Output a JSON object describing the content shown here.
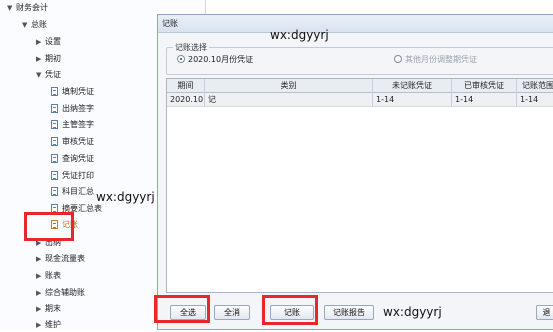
{
  "tree": {
    "items": [
      {
        "label": "财务会计",
        "arrow": "▼",
        "kind": "folder"
      },
      {
        "label": "总账",
        "arrow": "▼",
        "kind": "folder"
      },
      {
        "label": "设置",
        "arrow": "▶",
        "kind": "folder"
      },
      {
        "label": "期初",
        "arrow": "▶",
        "kind": "folder"
      },
      {
        "label": "凭证",
        "arrow": "▼",
        "kind": "folder"
      },
      {
        "label": "填制凭证",
        "kind": "doc"
      },
      {
        "label": "出纳签字",
        "kind": "doc"
      },
      {
        "label": "主管签字",
        "kind": "doc"
      },
      {
        "label": "审核凭证",
        "kind": "doc"
      },
      {
        "label": "查询凭证",
        "kind": "doc"
      },
      {
        "label": "凭证打印",
        "kind": "doc"
      },
      {
        "label": "科目汇总",
        "kind": "doc"
      },
      {
        "label": "摘要汇总表",
        "kind": "doc"
      },
      {
        "label": "记账",
        "kind": "doc",
        "selected": true
      },
      {
        "label": "出纳",
        "arrow": "▶",
        "kind": "folder"
      },
      {
        "label": "现金流量表",
        "arrow": "▶",
        "kind": "folder"
      },
      {
        "label": "账表",
        "arrow": "▶",
        "kind": "folder"
      },
      {
        "label": "综合辅助账",
        "arrow": "▶",
        "kind": "folder"
      },
      {
        "label": "期末",
        "arrow": "▶",
        "kind": "folder"
      },
      {
        "label": "维护",
        "arrow": "▶",
        "kind": "folder"
      }
    ]
  },
  "watermarks": {
    "top": "wx:dgyyrj",
    "left": "wx:dgyyrj",
    "bottom": "wx:dgyyrj"
  },
  "dialog": {
    "title": "记账",
    "group_label": "记账选择",
    "radio_current": "2020.10月份凭证",
    "radio_other": "其他月份调整期凭证",
    "columns": [
      "期间",
      "类别",
      "未记账凭证",
      "已审核凭证",
      "记账范围"
    ],
    "rows": [
      [
        "2020.10",
        "记",
        "1-14",
        "1-14",
        "1-14"
      ]
    ],
    "buttons": {
      "select_all": "全选",
      "clear_all": "全消",
      "post": "记账",
      "report": "记账报告",
      "exit": "退"
    }
  },
  "colors": {
    "highlight_border": "#e8262b",
    "selected_text": "#c36b0c"
  }
}
